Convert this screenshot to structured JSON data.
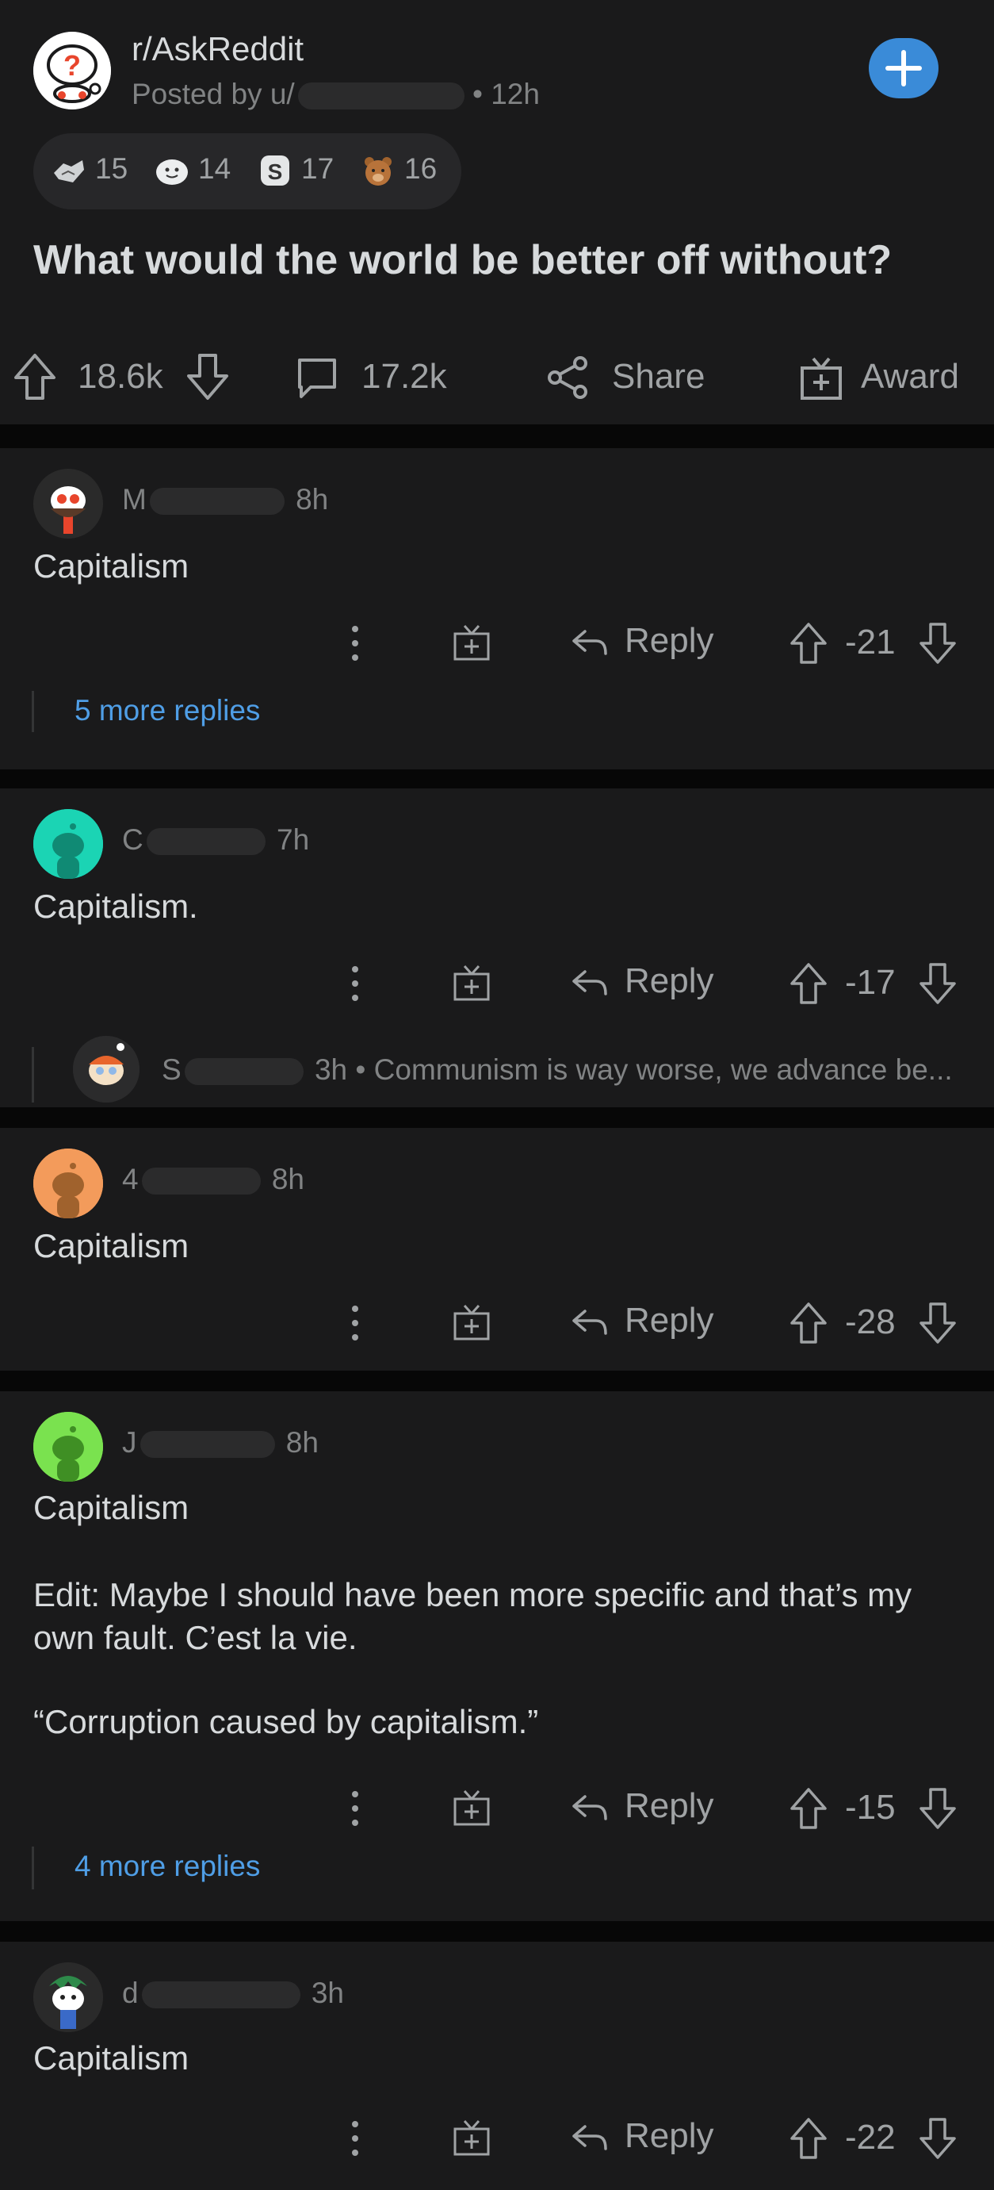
{
  "post": {
    "subreddit": "r/AskReddit",
    "posted_by_prefix": "Posted by u/",
    "age": "• 12h",
    "awards": [
      {
        "icon": "handshake-award-icon",
        "count": "15"
      },
      {
        "icon": "wholesome-seal-award-icon",
        "count": "14"
      },
      {
        "icon": "silver-coin-award-icon",
        "count": "17"
      },
      {
        "icon": "bear-award-icon",
        "count": "16"
      }
    ],
    "title": "What would the world be better off without?",
    "upvotes": "18.6k",
    "comments": "17.2k",
    "share_label": "Share",
    "award_label": "Award"
  },
  "comments": [
    {
      "author_partial": "M",
      "age": "8h",
      "body": "Capitalism",
      "reply_label": "Reply",
      "score": "-21",
      "more_replies": "5 more replies",
      "avatar_color": "#ffffff"
    },
    {
      "author_partial": "C",
      "age": "7h",
      "body": "Capitalism.",
      "reply_label": "Reply",
      "score": "-17",
      "child": {
        "author_partial": "S",
        "age": "3h",
        "snippet": "• Communism is way worse, we advance be..."
      },
      "avatar_color": "#1bd4b4"
    },
    {
      "author_partial": "4",
      "age": "8h",
      "body": "Capitalism",
      "reply_label": "Reply",
      "score": "-28",
      "avatar_color": "#f39b5b"
    },
    {
      "author_partial": "J",
      "age": "8h",
      "body": "Capitalism",
      "edit": "Edit: Maybe I should have been more specific and that’s my own fault. C’est la vie.",
      "quote": "“Corruption caused by capitalism.”",
      "reply_label": "Reply",
      "score": "-15",
      "more_replies": "4 more replies",
      "avatar_color": "#7ae24f"
    },
    {
      "author_partial": "d",
      "age": "3h",
      "body": "Capitalism",
      "reply_label": "Reply",
      "score": "-22",
      "avatar_color": "#1f3b2a"
    }
  ],
  "colors": {
    "accent": "#3a8bd8",
    "link": "#4f9ee6",
    "background": "#1a1a1b"
  }
}
